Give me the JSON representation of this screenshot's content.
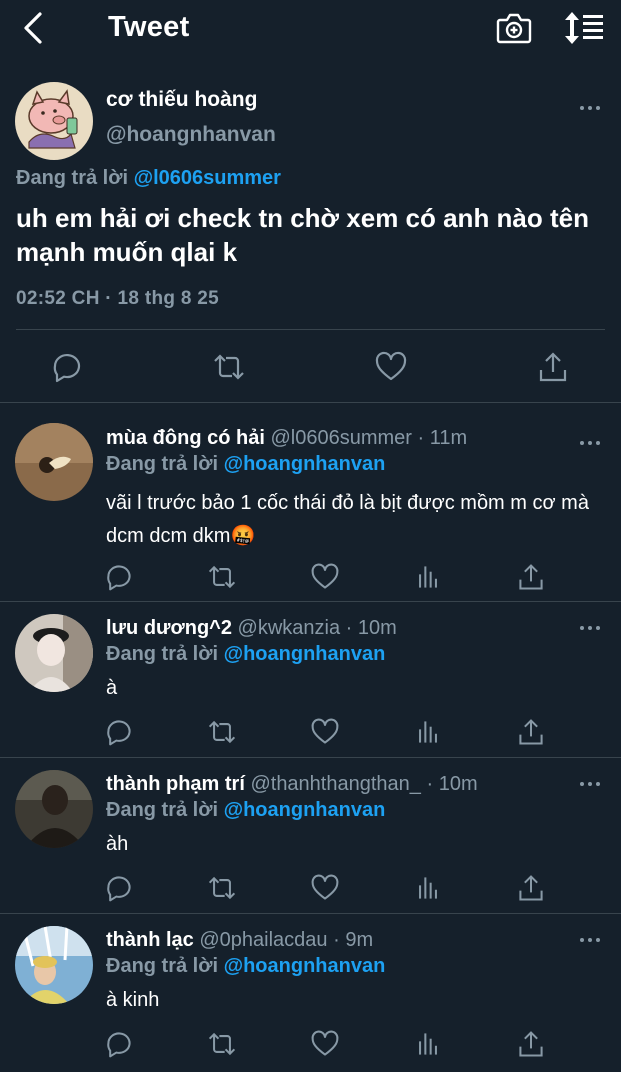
{
  "header": {
    "title": "Tweet"
  },
  "main_tweet": {
    "name": "cơ thiếu hoàng",
    "handle": "@hoangnhanvan",
    "replying_prefix": "Đang trả lời",
    "replying_to": "@l0606summer",
    "text": "uh em hải ơi check tn chờ xem có anh nào tên mạnh muốn qlai k",
    "timestamp": "02:52 CH · 18 thg 8 25"
  },
  "replies": [
    {
      "name": "mùa đông có hải",
      "handle": "@l0606summer",
      "dot": "·",
      "time": "11m",
      "replying_prefix": "Đang trả lời",
      "replying_to": "@hoangnhanvan",
      "text": "vãi l trước bảo 1 cốc thái đỏ là bịt được mồm m cơ mà dcm dcm dkm🤬"
    },
    {
      "name": "lưu dương^2",
      "handle": "@kwkanzia",
      "dot": "·",
      "time": "10m",
      "replying_prefix": "Đang trả lời",
      "replying_to": "@hoangnhanvan",
      "text": "à"
    },
    {
      "name": "thành phạm trí",
      "handle": "@thanhthangthan_",
      "dot": "·",
      "time": "10m",
      "replying_prefix": "Đang trả lời",
      "replying_to": "@hoangnhanvan",
      "text": "àh"
    },
    {
      "name": "thành lạc",
      "handle": "@0phailacdau",
      "dot": "·",
      "time": "9m",
      "replying_prefix": "Đang trả lời",
      "replying_to": "@hoangnhanvan",
      "text": "à kinh"
    }
  ],
  "colors": {
    "background": "#15202b",
    "secondary_text": "#8899a6",
    "accent": "#1da1f2",
    "divider": "#38444d"
  },
  "icons": {
    "header": [
      "back-chevron-icon",
      "camera-plus-icon",
      "sort-icon"
    ],
    "actions": [
      "reply-icon",
      "retweet-icon",
      "like-icon",
      "analytics-icon",
      "share-icon"
    ]
  }
}
